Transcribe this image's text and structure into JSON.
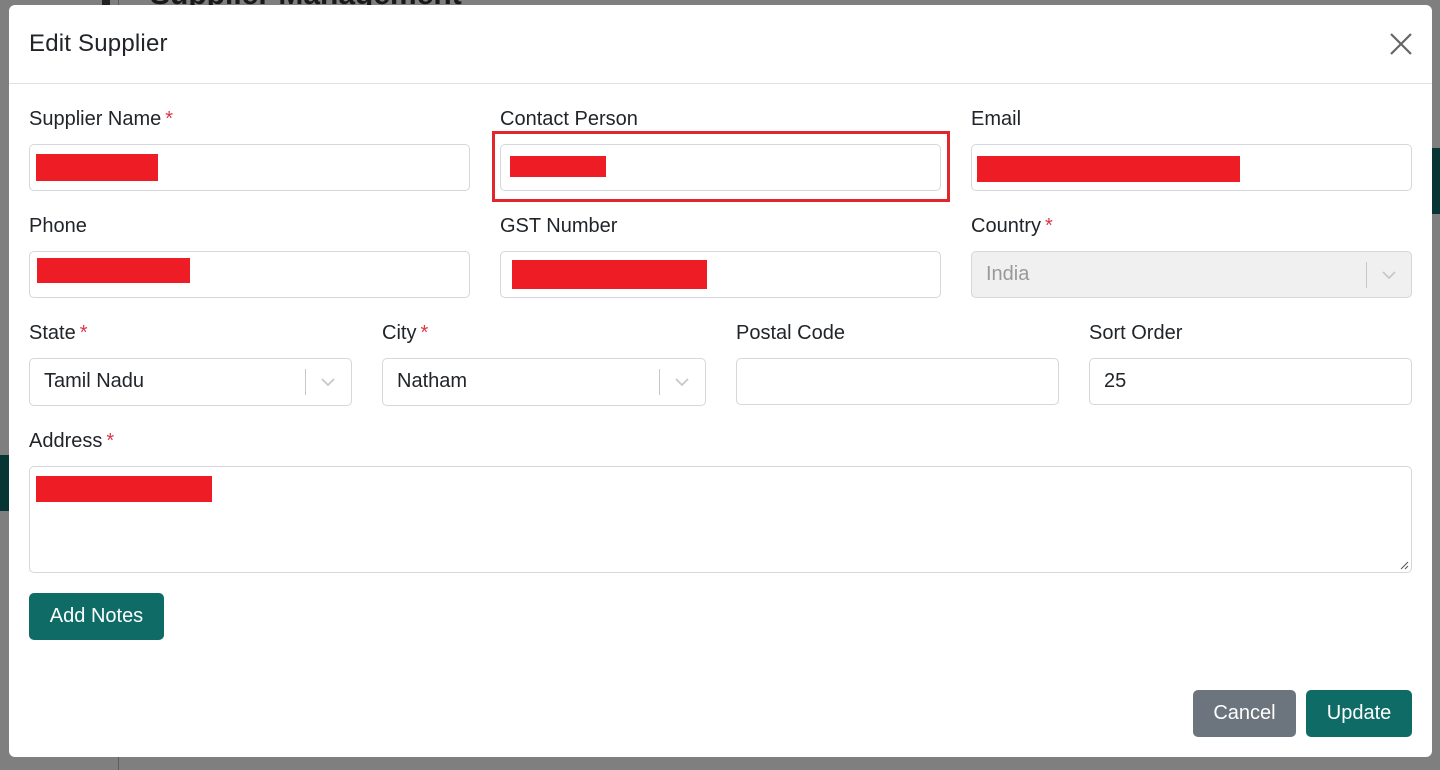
{
  "modal": {
    "title": "Edit Supplier",
    "close_icon": "close-icon"
  },
  "background": {
    "page_title": "Supplier Management"
  },
  "fields": {
    "supplier_name": {
      "label": "Supplier Name",
      "required": "*"
    },
    "contact_person": {
      "label": "Contact Person"
    },
    "email": {
      "label": "Email"
    },
    "phone": {
      "label": "Phone"
    },
    "gst_number": {
      "label": "GST Number"
    },
    "country": {
      "label": "Country",
      "required": "*",
      "value": "India"
    },
    "state": {
      "label": "State",
      "required": "*",
      "value": "Tamil Nadu"
    },
    "city": {
      "label": "City",
      "required": "*",
      "value": "Natham"
    },
    "postal_code": {
      "label": "Postal Code",
      "value": ""
    },
    "sort_order": {
      "label": "Sort Order",
      "value": "25"
    },
    "address": {
      "label": "Address",
      "required": "*"
    }
  },
  "buttons": {
    "add_notes": "Add Notes",
    "cancel": "Cancel",
    "update": "Update"
  },
  "colors": {
    "primary": "#0f6b66",
    "secondary": "#6c757d",
    "required": "#dc3545",
    "highlight": "#e1262d",
    "redaction": "#ee1c25"
  }
}
